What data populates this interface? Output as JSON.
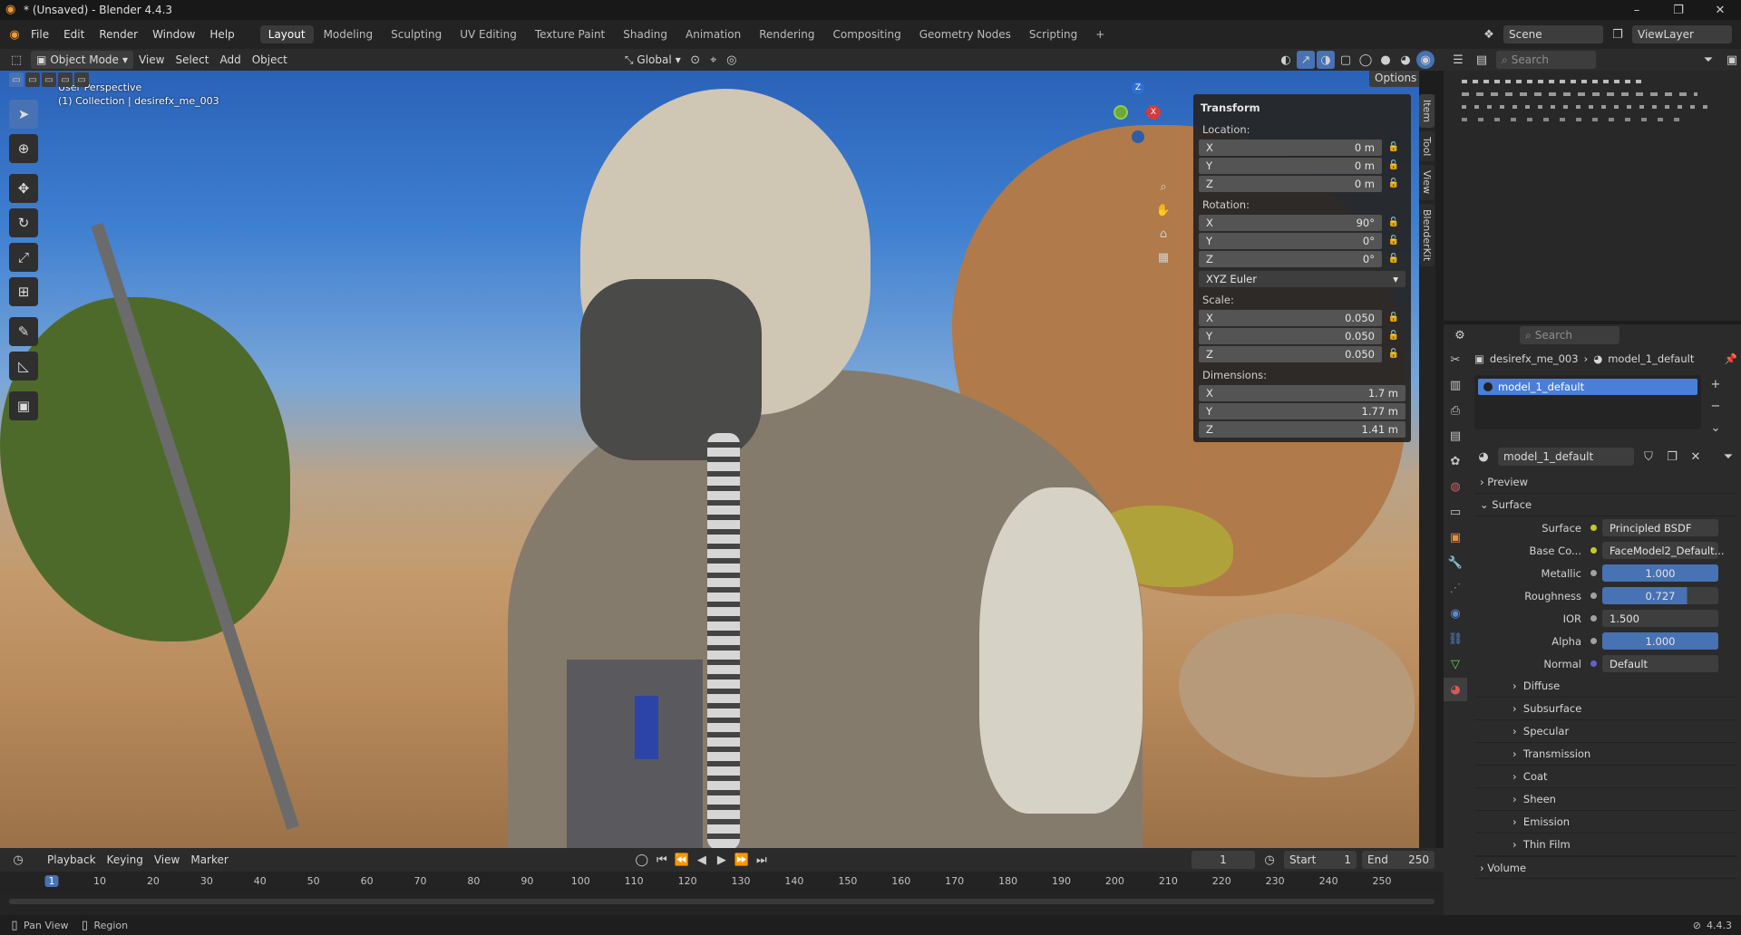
{
  "window": {
    "title": "* (Unsaved) - Blender 4.4.3",
    "minimize": "–",
    "maximize": "❐",
    "close": "✕"
  },
  "menu": [
    "File",
    "Edit",
    "Render",
    "Window",
    "Help"
  ],
  "workspaces": [
    "Layout",
    "Modeling",
    "Sculpting",
    "UV Editing",
    "Texture Paint",
    "Shading",
    "Animation",
    "Rendering",
    "Compositing",
    "Geometry Nodes",
    "Scripting"
  ],
  "active_workspace": "Layout",
  "scene": {
    "name": "Scene",
    "view_layer": "ViewLayer"
  },
  "viewport_header": {
    "mode": "Object Mode",
    "menus": [
      "View",
      "Select",
      "Add",
      "Object"
    ],
    "orientation": "Global",
    "options": "Options"
  },
  "overlay_text": {
    "perspective": "User Perspective",
    "collection": "(1) Collection | desirefx_me_003"
  },
  "gizmo": {
    "z": "Z",
    "x": "X"
  },
  "npanel": {
    "title": "Transform",
    "location_label": "Location:",
    "location": [
      {
        "axis": "X",
        "value": "0 m"
      },
      {
        "axis": "Y",
        "value": "0 m"
      },
      {
        "axis": "Z",
        "value": "0 m"
      }
    ],
    "rotation_label": "Rotation:",
    "rotation": [
      {
        "axis": "X",
        "value": "90°"
      },
      {
        "axis": "Y",
        "value": "0°"
      },
      {
        "axis": "Z",
        "value": "0°"
      }
    ],
    "rotation_mode": "XYZ Euler",
    "scale_label": "Scale:",
    "scale": [
      {
        "axis": "X",
        "value": "0.050"
      },
      {
        "axis": "Y",
        "value": "0.050"
      },
      {
        "axis": "Z",
        "value": "0.050"
      }
    ],
    "dimensions_label": "Dimensions:",
    "dimensions": [
      {
        "axis": "X",
        "value": "1.7 m"
      },
      {
        "axis": "Y",
        "value": "1.77 m"
      },
      {
        "axis": "Z",
        "value": "1.41 m"
      }
    ]
  },
  "side_tabs": [
    "Item",
    "Tool",
    "View",
    "BlenderKit"
  ],
  "outliner": {
    "search_placeholder": "Search"
  },
  "properties": {
    "search_placeholder": "Search",
    "breadcrumb_object": "desirefx_me_003",
    "breadcrumb_material": "model_1_default",
    "slot": "model_1_default",
    "material_name": "model_1_default",
    "preview": "Preview",
    "surface_section": "Surface",
    "rows": [
      {
        "label": "Surface",
        "value": "Principled BSDF",
        "type": "field"
      },
      {
        "label": "Base Co...",
        "value": "FaceModel2_Default...",
        "type": "field"
      },
      {
        "label": "Metallic",
        "value": "1.000",
        "type": "slider",
        "fill": 1.0
      },
      {
        "label": "Roughness",
        "value": "0.727",
        "type": "slider",
        "fill": 0.727
      },
      {
        "label": "IOR",
        "value": "1.500",
        "type": "field"
      },
      {
        "label": "Alpha",
        "value": "1.000",
        "type": "slider",
        "fill": 1.0
      },
      {
        "label": "Normal",
        "value": "Default",
        "type": "field"
      }
    ],
    "subsections": [
      "Diffuse",
      "Subsurface",
      "Specular",
      "Transmission",
      "Coat",
      "Sheen",
      "Emission",
      "Thin Film"
    ],
    "volume": "Volume"
  },
  "timeline": {
    "menus": [
      "Playback",
      "Keying",
      "View",
      "Marker"
    ],
    "current_frame": "1",
    "start_label": "Start",
    "start": "1",
    "end_label": "End",
    "end": "250",
    "ticks": [
      "1",
      "10",
      "20",
      "30",
      "40",
      "50",
      "60",
      "70",
      "80",
      "90",
      "100",
      "110",
      "120",
      "130",
      "140",
      "150",
      "160",
      "170",
      "180",
      "190",
      "200",
      "210",
      "220",
      "230",
      "240",
      "250"
    ]
  },
  "statusbar": {
    "pan": "Pan View",
    "region": "Region",
    "version": "4.4.3"
  },
  "colors": {
    "accent": "#4772b3",
    "selection": "#4a7ed8",
    "socket_yellow": "#c7c729",
    "socket_grey": "#a1a1a1",
    "socket_purple": "#6363c7"
  }
}
